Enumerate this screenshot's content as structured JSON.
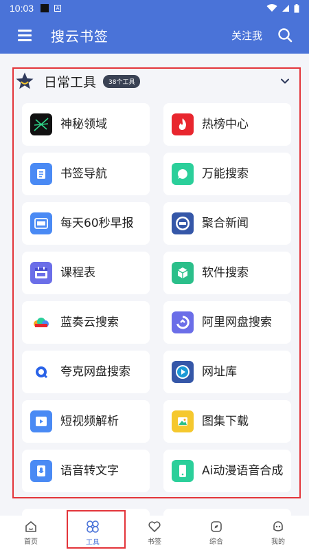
{
  "status": {
    "time": "10:03"
  },
  "appbar": {
    "title": "搜云书签",
    "follow": "关注我"
  },
  "section": {
    "title": "日常工具",
    "badge": "38个工具"
  },
  "tools": [
    {
      "label": "神秘领域",
      "icon": "mystery-realm-icon",
      "color": "#111111"
    },
    {
      "label": "热榜中心",
      "icon": "flame-icon",
      "color": "#e8262e"
    },
    {
      "label": "书签导航",
      "icon": "bookmark-nav-icon",
      "color": "#4a8af4"
    },
    {
      "label": "万能搜索",
      "icon": "chat-search-icon",
      "color": "#2bcf9a"
    },
    {
      "label": "每天60秒早报",
      "icon": "news-icon",
      "color": "#4a8af4"
    },
    {
      "label": "聚合新闻",
      "icon": "news-circle-icon",
      "color": "#3557a8"
    },
    {
      "label": "课程表",
      "icon": "calendar-icon",
      "color": "#6b6ee8"
    },
    {
      "label": "软件搜索",
      "icon": "cube-icon",
      "color": "#2bbf8a"
    },
    {
      "label": "蓝奏云搜索",
      "icon": "cloud-icon",
      "color": "#ffffff"
    },
    {
      "label": "阿里网盘搜索",
      "icon": "aliyun-drive-icon",
      "color": "#6b6ee8"
    },
    {
      "label": "夸克网盘搜索",
      "icon": "quark-icon",
      "color": "#ffffff"
    },
    {
      "label": "网址库",
      "icon": "link-play-icon",
      "color": "#3557a8"
    },
    {
      "label": "短视频解析",
      "icon": "video-icon",
      "color": "#4a8af4"
    },
    {
      "label": "图集下载",
      "icon": "image-icon",
      "color": "#f5c82e"
    },
    {
      "label": "语音转文字",
      "icon": "voice-icon",
      "color": "#4a8af4"
    },
    {
      "label": "Ai动漫语音合成",
      "icon": "phone-icon",
      "color": "#2bcf9a"
    }
  ],
  "tabs": [
    {
      "label": "首页",
      "icon": "home-icon"
    },
    {
      "label": "工具",
      "icon": "tools-icon",
      "active": true
    },
    {
      "label": "书签",
      "icon": "heart-icon"
    },
    {
      "label": "综合",
      "icon": "compass-icon"
    },
    {
      "label": "我的",
      "icon": "profile-icon"
    }
  ]
}
